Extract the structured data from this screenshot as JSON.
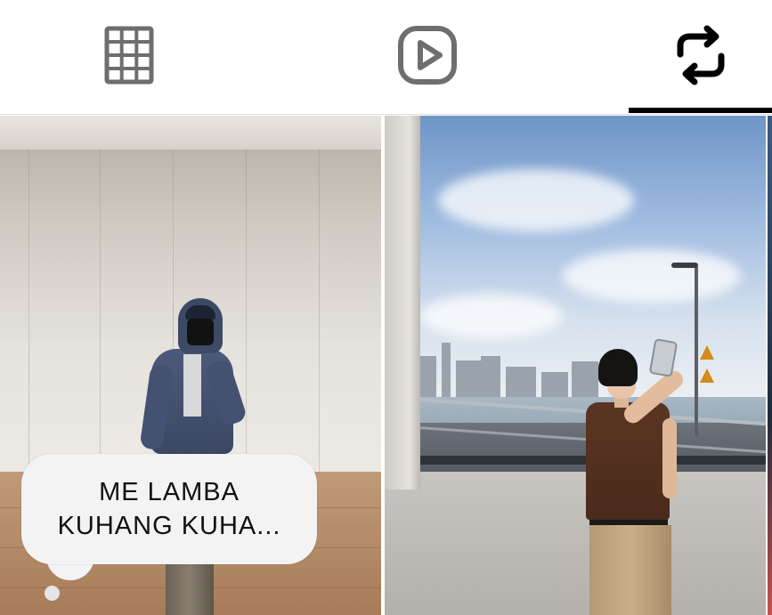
{
  "tabs": [
    {
      "id": "posts",
      "icon": "grid-icon",
      "active": false
    },
    {
      "id": "reels",
      "icon": "reels-play-icon",
      "active": false
    },
    {
      "id": "reposts",
      "icon": "repost-icon",
      "active": true
    }
  ],
  "colors": {
    "active_tab_indicator": "#000000",
    "inactive_icon": "#6e6e6e",
    "active_icon": "#000000",
    "bubble_bg": "#f3f3f3"
  },
  "posts": [
    {
      "kind": "video",
      "caption_bubble": {
        "line1": "ME LAMBA",
        "line2": "KUHANG KUHA..."
      }
    },
    {
      "kind": "photo"
    },
    {
      "kind": "photo"
    }
  ]
}
